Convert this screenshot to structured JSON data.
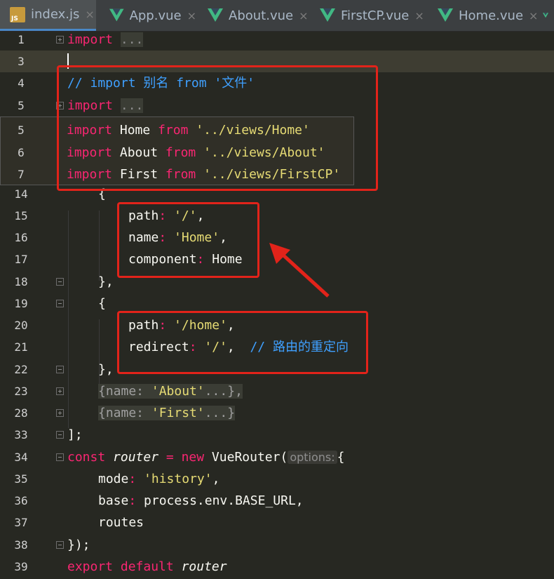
{
  "tabs": [
    {
      "label": "index.js",
      "icon": "js-file-icon",
      "active": true
    },
    {
      "label": "App.vue",
      "icon": "vue-file-icon",
      "active": false
    },
    {
      "label": "About.vue",
      "icon": "vue-file-icon",
      "active": false
    },
    {
      "label": "FirstCP.vue",
      "icon": "vue-file-icon",
      "active": false
    },
    {
      "label": "Home.vue",
      "icon": "vue-file-icon",
      "active": false
    }
  ],
  "close_glyph": "×",
  "js_badge": "JS",
  "colors": {
    "keyword": "#f92672",
    "string": "#e6db74",
    "comment": "#3fa0ff",
    "annotation_box": "#e2231a",
    "background": "#272822"
  },
  "lines": {
    "l1": {
      "num": "1",
      "kw": "import",
      "dots": "..."
    },
    "l3": {
      "num": "3"
    },
    "l4": {
      "num": "4",
      "comment": "// import 别名 from '文件'"
    },
    "l5": {
      "num": "5",
      "kw": "import",
      "dots": "..."
    },
    "p5": {
      "num": "5",
      "kw": "import",
      "name": "Home",
      "from": "from",
      "path": "'../views/Home'"
    },
    "p6": {
      "num": "6",
      "kw": "import",
      "name": "About",
      "from": "from",
      "path": "'../views/About'"
    },
    "p7": {
      "num": "7",
      "kw": "import",
      "name": "First",
      "from": "from",
      "path": "'../views/FirstCP'"
    },
    "l14": {
      "num": "14",
      "text": "{"
    },
    "l15": {
      "num": "15",
      "key": "path",
      "value": "'/'",
      "tail": ","
    },
    "l16": {
      "num": "16",
      "key": "name",
      "value": "'Home'",
      "tail": ","
    },
    "l17": {
      "num": "17",
      "key": "component",
      "value": "Home"
    },
    "l18": {
      "num": "18",
      "text": "},"
    },
    "l19": {
      "num": "19",
      "text": "{"
    },
    "l20": {
      "num": "20",
      "key": "path",
      "value": "'/home'",
      "tail": ","
    },
    "l21": {
      "num": "21",
      "key": "redirect",
      "value": "'/'",
      "tail": ",",
      "comment": "// 路由的重定向"
    },
    "l22": {
      "num": "22",
      "text": "},"
    },
    "l23": {
      "num": "23",
      "open": "{name: ",
      "value": "'About'",
      "close": "...},"
    },
    "l28": {
      "num": "28",
      "open": "{name: ",
      "value": "'First'",
      "close": "...}"
    },
    "l33": {
      "num": "33",
      "text": "];"
    },
    "l34": {
      "num": "34",
      "kw": "const",
      "var": "router",
      "eq": " = ",
      "new": "new",
      "cls": " VueRouter(",
      "hint": "options:",
      "brace": "{"
    },
    "l35": {
      "num": "35",
      "key": "mode",
      "value": "'history'",
      "tail": ","
    },
    "l36": {
      "num": "36",
      "key": "base",
      "value": "process.env.BASE_URL",
      "tail": ","
    },
    "l37": {
      "num": "37",
      "text": "routes"
    },
    "l38": {
      "num": "38",
      "text": "});"
    },
    "l39": {
      "num": "39",
      "kw": "export",
      "kw2": "default",
      "var": "router"
    }
  }
}
